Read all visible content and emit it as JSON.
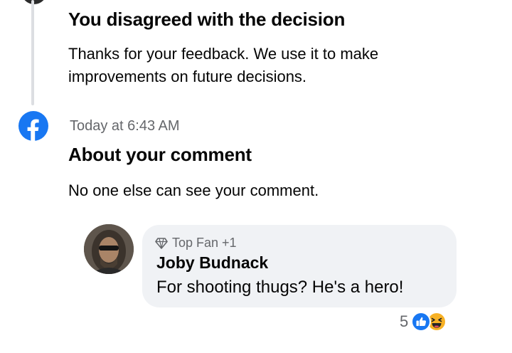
{
  "feed": {
    "item1": {
      "title": "You disagreed with the decision",
      "body": "Thanks for your feedback. We use it to make improvements on future decisions."
    },
    "item2": {
      "source_icon": "facebook-icon",
      "timestamp": "Today at 6:43 AM",
      "title": "About your comment",
      "body": "No one else can see your comment."
    }
  },
  "comment": {
    "badge_icon": "diamond-icon",
    "badge": "Top Fan +1",
    "author": "Joby Budnack",
    "text": "For shooting thugs?  He's a hero!",
    "reaction_count": "5",
    "reaction_icons": [
      "like-icon",
      "haha-icon"
    ]
  },
  "colors": {
    "facebook_blue": "#1877f2",
    "bubble_bg": "#f0f2f5",
    "secondary_text": "#65676b",
    "timeline_line": "#dcdee2"
  }
}
